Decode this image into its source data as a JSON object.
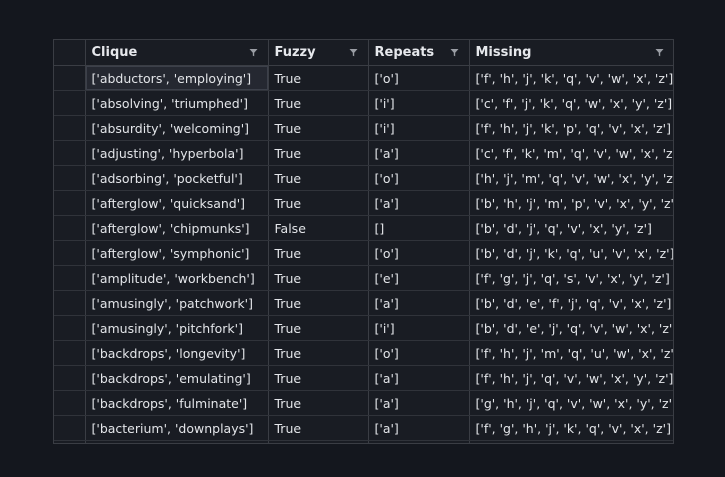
{
  "table": {
    "columns": [
      {
        "label": "Clique",
        "filter_icon": "filter-icon"
      },
      {
        "label": "Fuzzy",
        "filter_icon": "filter-icon"
      },
      {
        "label": "Repeats",
        "filter_icon": "filter-icon"
      },
      {
        "label": "Missing",
        "filter_icon": "filter-icon"
      }
    ],
    "rows": [
      {
        "clique": "['abductors', 'employing']",
        "fuzzy": "True",
        "repeats": "['o']",
        "missing": "['f', 'h', 'j', 'k', 'q', 'v', 'w', 'x', 'z']"
      },
      {
        "clique": "['absolving', 'triumphed']",
        "fuzzy": "True",
        "repeats": "['i']",
        "missing": "['c', 'f', 'j', 'k', 'q', 'w', 'x', 'y', 'z']"
      },
      {
        "clique": "['absurdity', 'welcoming']",
        "fuzzy": "True",
        "repeats": "['i']",
        "missing": "['f', 'h', 'j', 'k', 'p', 'q', 'v', 'x', 'z']"
      },
      {
        "clique": "['adjusting', 'hyperbola']",
        "fuzzy": "True",
        "repeats": "['a']",
        "missing": "['c', 'f', 'k', 'm', 'q', 'v', 'w', 'x', 'z']"
      },
      {
        "clique": "['adsorbing', 'pocketful']",
        "fuzzy": "True",
        "repeats": "['o']",
        "missing": "['h', 'j', 'm', 'q', 'v', 'w', 'x', 'y', 'z']"
      },
      {
        "clique": "['afterglow', 'quicksand']",
        "fuzzy": "True",
        "repeats": "['a']",
        "missing": "['b', 'h', 'j', 'm', 'p', 'v', 'x', 'y', 'z']"
      },
      {
        "clique": "['afterglow', 'chipmunks']",
        "fuzzy": "False",
        "repeats": "[]",
        "missing": "['b', 'd', 'j', 'q', 'v', 'x', 'y', 'z']"
      },
      {
        "clique": "['afterglow', 'symphonic']",
        "fuzzy": "True",
        "repeats": "['o']",
        "missing": "['b', 'd', 'j', 'k', 'q', 'u', 'v', 'x', 'z']"
      },
      {
        "clique": "['amplitude', 'workbench']",
        "fuzzy": "True",
        "repeats": "['e']",
        "missing": "['f', 'g', 'j', 'q', 's', 'v', 'x', 'y', 'z']"
      },
      {
        "clique": "['amusingly', 'patchwork']",
        "fuzzy": "True",
        "repeats": "['a']",
        "missing": "['b', 'd', 'e', 'f', 'j', 'q', 'v', 'x', 'z']"
      },
      {
        "clique": "['amusingly', 'pitchfork']",
        "fuzzy": "True",
        "repeats": "['i']",
        "missing": "['b', 'd', 'e', 'j', 'q', 'v', 'w', 'x', 'z']"
      },
      {
        "clique": "['backdrops', 'longevity']",
        "fuzzy": "True",
        "repeats": "['o']",
        "missing": "['f', 'h', 'j', 'm', 'q', 'u', 'w', 'x', 'z']"
      },
      {
        "clique": "['backdrops', 'emulating']",
        "fuzzy": "True",
        "repeats": "['a']",
        "missing": "['f', 'h', 'j', 'q', 'v', 'w', 'x', 'y', 'z']"
      },
      {
        "clique": "['backdrops', 'fulminate']",
        "fuzzy": "True",
        "repeats": "['a']",
        "missing": "['g', 'h', 'j', 'q', 'v', 'w', 'x', 'y', 'z']"
      },
      {
        "clique": "['bacterium', 'downplays']",
        "fuzzy": "True",
        "repeats": "['a']",
        "missing": "['f', 'g', 'h', 'j', 'k', 'q', 'v', 'x', 'z']"
      },
      {
        "clique": "",
        "fuzzy": "",
        "repeats": "",
        "missing": ""
      }
    ]
  },
  "colors": {
    "background": "#14171e",
    "grid_background": "#191c23",
    "grid_lines": "#3a3d44",
    "text": "#e3e5e9",
    "icon": "#9a9da4"
  }
}
